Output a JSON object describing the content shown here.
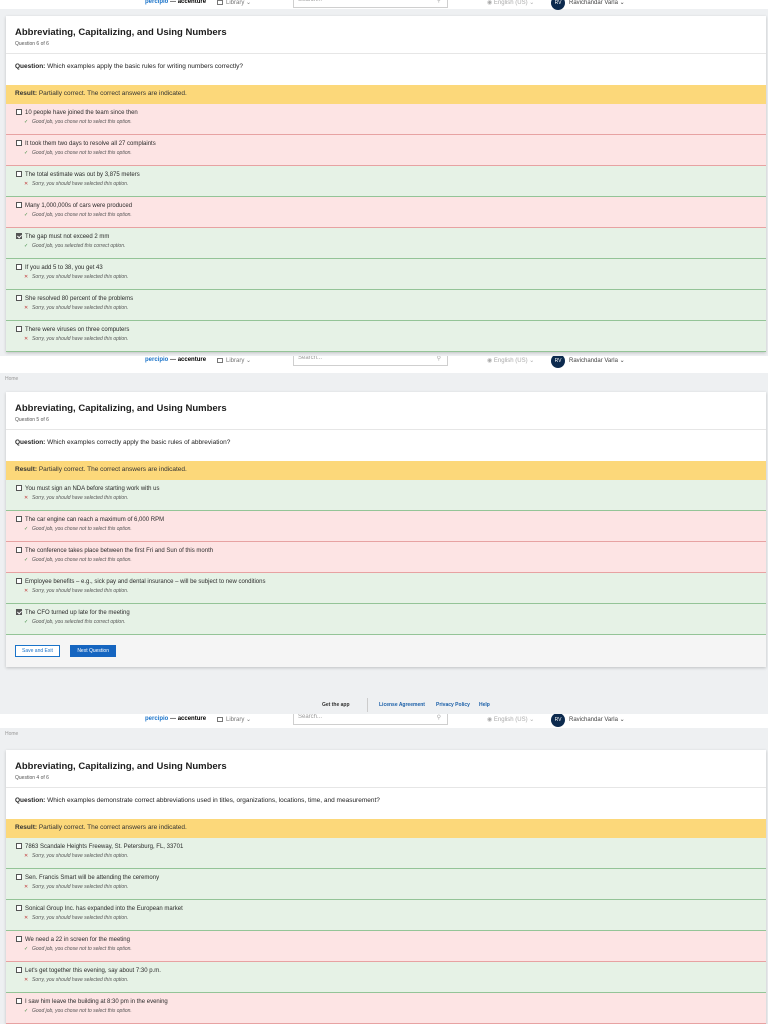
{
  "header": {
    "logo_main": "percipio",
    "logo_sep": " — ",
    "logo_brand": "accenture",
    "library": "Library",
    "search_placeholder": "Search...",
    "language": "English (US)",
    "avatar_initials": "RV",
    "user_name": "Ravichandar Varla",
    "chevron": "⌄"
  },
  "breadcrumb": "Home",
  "labels": {
    "question_prefix": "Question:",
    "result_prefix": "Result:",
    "result_text": "Partially correct. The correct answers are indicated."
  },
  "feedback": {
    "ok_mark": "✓",
    "no_mark": "✕"
  },
  "screens": [
    {
      "title": "Abbreviating, Capitalizing, and Using Numbers",
      "subtitle": "Question 6 of 6",
      "question": "Which examples apply the basic rules for writing numbers correctly?",
      "options": [
        {
          "text": "10 people have joined the team since then",
          "checked": false,
          "status": "red",
          "mark": "ok",
          "feedback": "Good job, you chose not to select this option."
        },
        {
          "text": "It took them two days to resolve all 27 complaints",
          "checked": false,
          "status": "red",
          "mark": "ok",
          "feedback": "Good job, you chose not to select this option."
        },
        {
          "text": "The total estimate was out by 3,875 meters",
          "checked": false,
          "status": "green",
          "mark": "no",
          "feedback": "Sorry, you should have selected this option."
        },
        {
          "text": "Many 1,000,000s of cars were produced",
          "checked": false,
          "status": "red",
          "mark": "ok",
          "feedback": "Good job, you chose not to select this option."
        },
        {
          "text": "The gap must not exceed 2 mm",
          "checked": true,
          "status": "green",
          "mark": "ok",
          "feedback": "Good job, you selected this correct option."
        },
        {
          "text": "If you add 5 to 38, you get 43",
          "checked": false,
          "status": "green",
          "mark": "no",
          "feedback": "Sorry, you should have selected this option."
        },
        {
          "text": "She resolved 80 percent of the problems",
          "checked": false,
          "status": "green",
          "mark": "no",
          "feedback": "Sorry, you should have selected this option."
        },
        {
          "text": "There were viruses on three computers",
          "checked": false,
          "status": "green",
          "mark": "no",
          "feedback": "Sorry, you should have selected this option."
        }
      ]
    },
    {
      "title": "Abbreviating, Capitalizing, and Using Numbers",
      "subtitle": "Question 5 of 6",
      "question": "Which examples correctly apply the basic rules of abbreviation?",
      "options": [
        {
          "text": "You must sign an NDA before starting work with us",
          "checked": false,
          "status": "green",
          "mark": "no",
          "feedback": "Sorry, you should have selected this option."
        },
        {
          "text": "The car engine can reach a maximum of 6,000 RPM",
          "checked": false,
          "status": "red",
          "mark": "ok",
          "feedback": "Good job, you chose not to select this option."
        },
        {
          "text": "The conference takes place between the first Fri and Sun of this month",
          "checked": false,
          "status": "red",
          "mark": "ok",
          "feedback": "Good job, you chose not to select this option."
        },
        {
          "text": "Employee benefits – e.g., sick pay and dental insurance – will be subject to new conditions",
          "checked": false,
          "status": "green",
          "mark": "no",
          "feedback": "Sorry, you should have selected this option."
        },
        {
          "text": "The CFO turned up late for the meeting",
          "checked": true,
          "status": "green",
          "mark": "ok",
          "feedback": "Good job, you selected this correct option."
        }
      ],
      "save_label": "Save and Exit",
      "next_label": "Next Question"
    },
    {
      "title": "Abbreviating, Capitalizing, and Using Numbers",
      "subtitle": "Question 4 of 6",
      "question": "Which examples demonstrate correct abbreviations used in titles, organizations, locations, time, and measurement?",
      "options": [
        {
          "text": "7863 Scandale Heights Freeway, St. Petersburg, FL, 33701",
          "checked": false,
          "status": "green",
          "mark": "no",
          "feedback": "Sorry, you should have selected this option."
        },
        {
          "text": "Sen. Francis Smart will be attending the ceremony",
          "checked": false,
          "status": "green",
          "mark": "no",
          "feedback": "Sorry, you should have selected this option."
        },
        {
          "text": "Sonical Group Inc. has expanded into the European market",
          "checked": false,
          "status": "green",
          "mark": "no",
          "feedback": "Sorry, you should have selected this option."
        },
        {
          "text": "We need a 22 in screen for the meeting",
          "checked": false,
          "status": "red",
          "mark": "ok",
          "feedback": "Good job, you chose not to select this option."
        },
        {
          "text": "Let's get together this evening, say about 7:30 p.m.",
          "checked": false,
          "status": "green",
          "mark": "no",
          "feedback": "Sorry, you should have selected this option."
        },
        {
          "text": "I saw him leave the building at 8:30 pm in the evening",
          "checked": false,
          "status": "red",
          "mark": "ok",
          "feedback": "Good job, you chose not to select this option."
        }
      ]
    }
  ],
  "footer": {
    "get_app": "Get the app",
    "license": "License Agreement",
    "privacy": "Privacy Policy",
    "help": "Help"
  }
}
